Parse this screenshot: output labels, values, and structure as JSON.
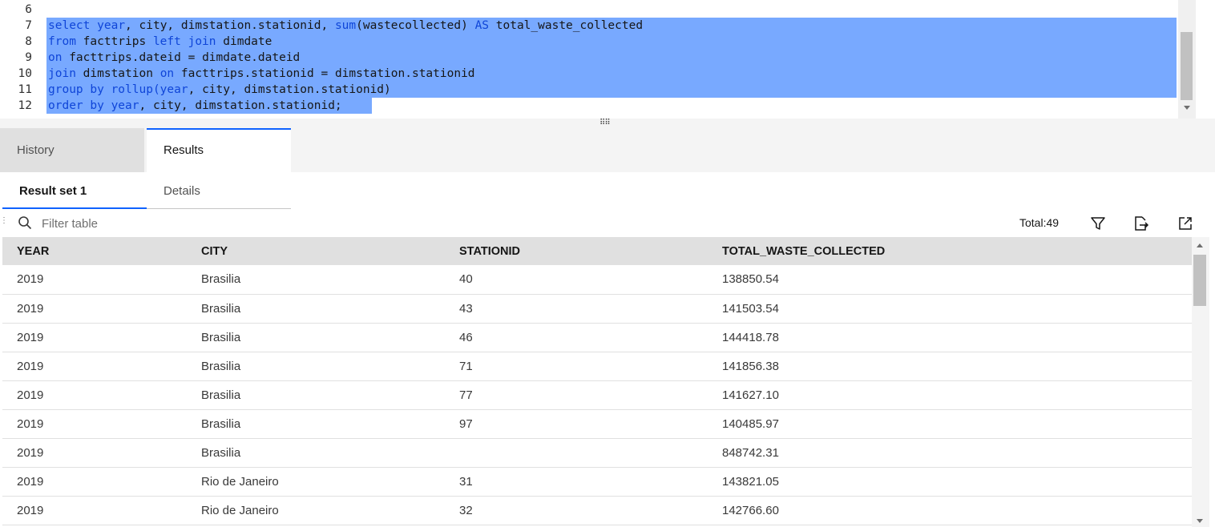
{
  "editor": {
    "lines": [
      {
        "num": "6",
        "selected": false,
        "tokens": []
      },
      {
        "num": "7",
        "selected": true,
        "tokens": [
          {
            "t": "select",
            "k": 1
          },
          {
            "t": " "
          },
          {
            "t": "year",
            "k": 1
          },
          {
            "t": ", city, dimstation.stationid, "
          },
          {
            "t": "sum",
            "k": 1
          },
          {
            "t": "(wastecollected) "
          },
          {
            "t": "AS",
            "k": 1
          },
          {
            "t": " total_waste_collected"
          }
        ]
      },
      {
        "num": "8",
        "selected": true,
        "tokens": [
          {
            "t": "from",
            "k": 1
          },
          {
            "t": " facttrips "
          },
          {
            "t": "left join",
            "k": 1
          },
          {
            "t": " dimdate"
          }
        ]
      },
      {
        "num": "9",
        "selected": true,
        "tokens": [
          {
            "t": "on",
            "k": 1
          },
          {
            "t": " facttrips.dateid = dimdate.dateid"
          }
        ]
      },
      {
        "num": "10",
        "selected": true,
        "tokens": [
          {
            "t": "join",
            "k": 1
          },
          {
            "t": " dimstation "
          },
          {
            "t": "on",
            "k": 1
          },
          {
            "t": " facttrips.stationid = dimstation.stationid"
          }
        ]
      },
      {
        "num": "11",
        "selected": true,
        "tokens": [
          {
            "t": "group by rollup(year",
            "k": 1
          },
          {
            "t": ", city, dimstation.stationid)"
          }
        ]
      },
      {
        "num": "12",
        "selected": true,
        "partial": true,
        "tokens": [
          {
            "t": "order by",
            "k": 1
          },
          {
            "t": " "
          },
          {
            "t": "year",
            "k": 1
          },
          {
            "t": ", city, dimstation.stationid;"
          }
        ]
      }
    ]
  },
  "tabs": [
    {
      "label": "History",
      "active": false
    },
    {
      "label": "Results",
      "active": true
    }
  ],
  "subtabs": [
    {
      "label": "Result set 1",
      "active": true
    },
    {
      "label": "Details",
      "active": false
    }
  ],
  "toolbar": {
    "filter_placeholder": "Filter table",
    "total_label": "Total:49",
    "icons": [
      "filter-icon",
      "export-icon",
      "open-new-window-icon"
    ]
  },
  "table": {
    "columns": [
      "YEAR",
      "CITY",
      "STATIONID",
      "TOTAL_WASTE_COLLECTED"
    ],
    "rows": [
      [
        "2019",
        "Brasilia",
        "40",
        "138850.54"
      ],
      [
        "2019",
        "Brasilia",
        "43",
        "141503.54"
      ],
      [
        "2019",
        "Brasilia",
        "46",
        "144418.78"
      ],
      [
        "2019",
        "Brasilia",
        "71",
        "141856.38"
      ],
      [
        "2019",
        "Brasilia",
        "77",
        "141627.10"
      ],
      [
        "2019",
        "Brasilia",
        "97",
        "140485.97"
      ],
      [
        "2019",
        "Brasilia",
        "",
        "848742.31"
      ],
      [
        "2019",
        "Rio de Janeiro",
        "31",
        "143821.05"
      ],
      [
        "2019",
        "Rio de Janeiro",
        "32",
        "142766.60"
      ]
    ]
  },
  "colors": {
    "selection": "#78a9ff",
    "keyword": "#0f45d8",
    "accent": "#0f62fe"
  }
}
